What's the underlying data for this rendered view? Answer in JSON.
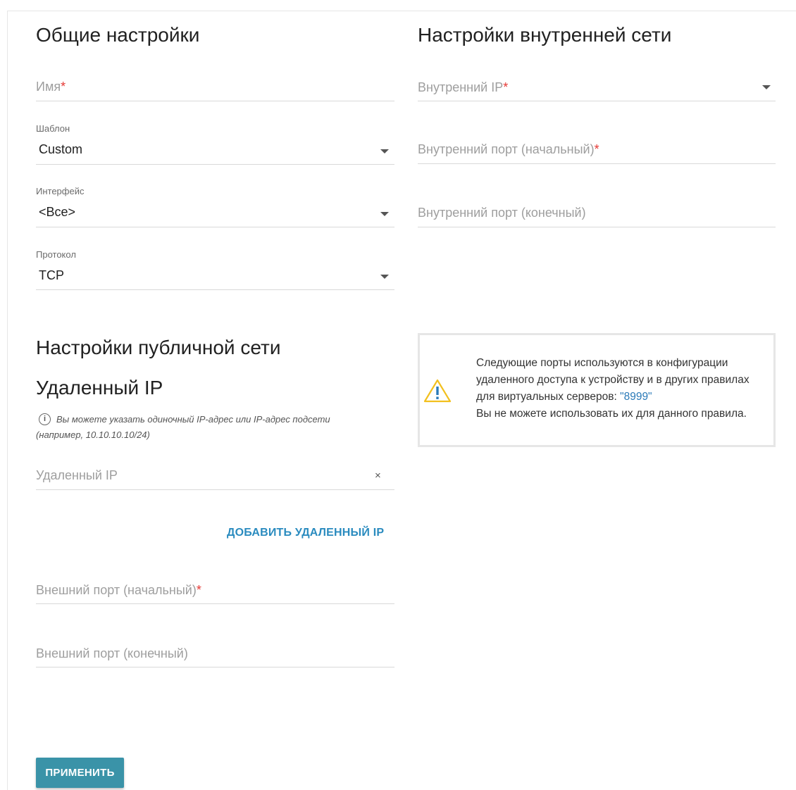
{
  "general": {
    "title": "Общие настройки",
    "name_placeholder": "Имя",
    "template_label": "Шаблон",
    "template_value": "Custom",
    "interface_label": "Интерфейс",
    "interface_value": "<Все>",
    "protocol_label": "Протокол",
    "protocol_value": "TCP"
  },
  "internal": {
    "title": "Настройки внутренней сети",
    "ip_placeholder": "Внутренний IP",
    "port_start_placeholder": "Внутренний порт (начальный)",
    "port_end_placeholder": "Внутренний порт (конечный)"
  },
  "public": {
    "title": "Настройки публичной сети",
    "remote_ip_title": "Удаленный IP",
    "hint_icon_glyph": "i",
    "hint_line1": "Вы можете указать одиночный IP-адрес или IP-адрес подсети",
    "hint_line2": "(например, 10.10.10.10/24)",
    "remote_ip_placeholder": "Удаленный IP",
    "clear_glyph": "×",
    "add_remote_ip_label": "ДОБАВИТЬ УДАЛЕННЫЙ IP",
    "ext_port_start_placeholder": "Внешний порт (начальный)",
    "ext_port_end_placeholder": "Внешний порт (конечный)"
  },
  "warning": {
    "text_before_port": "Следующие порты используются в конфигурации удаленного доступа к устройству и в других правилах для виртуальных серверов: ",
    "port": "\"8999\"",
    "text_after_port": "Вы не можете использовать их для данного правила."
  },
  "required_mark": "*",
  "apply_label": "ПРИМЕНИТЬ",
  "colors": {
    "accent": "#2a8bbf",
    "apply_button": "#3a93a8",
    "required": "#e53935",
    "warning_icon": "#f2c01e"
  }
}
